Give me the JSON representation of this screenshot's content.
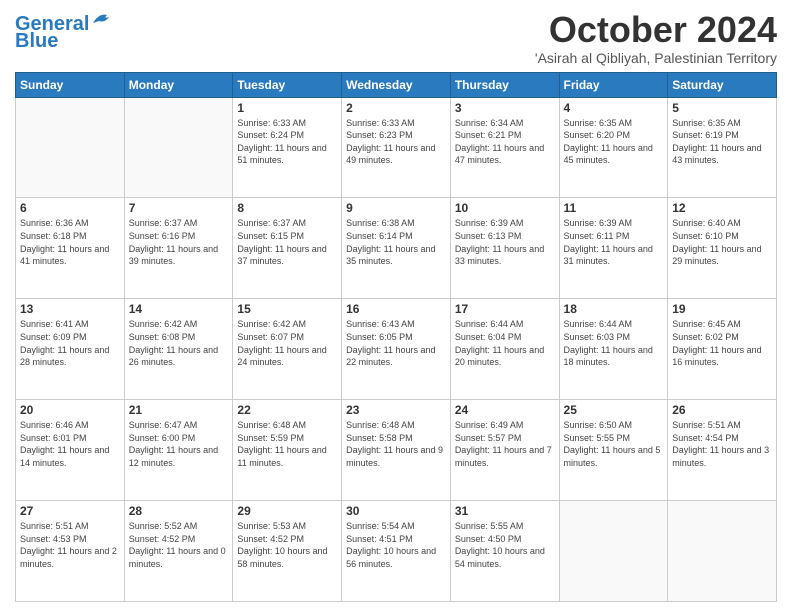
{
  "header": {
    "logo_line1": "General",
    "logo_line2": "Blue",
    "month": "October 2024",
    "location": "'Asirah al Qibliyah, Palestinian Territory"
  },
  "days_of_week": [
    "Sunday",
    "Monday",
    "Tuesday",
    "Wednesday",
    "Thursday",
    "Friday",
    "Saturday"
  ],
  "weeks": [
    [
      {
        "day": "",
        "info": ""
      },
      {
        "day": "",
        "info": ""
      },
      {
        "day": "1",
        "info": "Sunrise: 6:33 AM\nSunset: 6:24 PM\nDaylight: 11 hours and 51 minutes."
      },
      {
        "day": "2",
        "info": "Sunrise: 6:33 AM\nSunset: 6:23 PM\nDaylight: 11 hours and 49 minutes."
      },
      {
        "day": "3",
        "info": "Sunrise: 6:34 AM\nSunset: 6:21 PM\nDaylight: 11 hours and 47 minutes."
      },
      {
        "day": "4",
        "info": "Sunrise: 6:35 AM\nSunset: 6:20 PM\nDaylight: 11 hours and 45 minutes."
      },
      {
        "day": "5",
        "info": "Sunrise: 6:35 AM\nSunset: 6:19 PM\nDaylight: 11 hours and 43 minutes."
      }
    ],
    [
      {
        "day": "6",
        "info": "Sunrise: 6:36 AM\nSunset: 6:18 PM\nDaylight: 11 hours and 41 minutes."
      },
      {
        "day": "7",
        "info": "Sunrise: 6:37 AM\nSunset: 6:16 PM\nDaylight: 11 hours and 39 minutes."
      },
      {
        "day": "8",
        "info": "Sunrise: 6:37 AM\nSunset: 6:15 PM\nDaylight: 11 hours and 37 minutes."
      },
      {
        "day": "9",
        "info": "Sunrise: 6:38 AM\nSunset: 6:14 PM\nDaylight: 11 hours and 35 minutes."
      },
      {
        "day": "10",
        "info": "Sunrise: 6:39 AM\nSunset: 6:13 PM\nDaylight: 11 hours and 33 minutes."
      },
      {
        "day": "11",
        "info": "Sunrise: 6:39 AM\nSunset: 6:11 PM\nDaylight: 11 hours and 31 minutes."
      },
      {
        "day": "12",
        "info": "Sunrise: 6:40 AM\nSunset: 6:10 PM\nDaylight: 11 hours and 29 minutes."
      }
    ],
    [
      {
        "day": "13",
        "info": "Sunrise: 6:41 AM\nSunset: 6:09 PM\nDaylight: 11 hours and 28 minutes."
      },
      {
        "day": "14",
        "info": "Sunrise: 6:42 AM\nSunset: 6:08 PM\nDaylight: 11 hours and 26 minutes."
      },
      {
        "day": "15",
        "info": "Sunrise: 6:42 AM\nSunset: 6:07 PM\nDaylight: 11 hours and 24 minutes."
      },
      {
        "day": "16",
        "info": "Sunrise: 6:43 AM\nSunset: 6:05 PM\nDaylight: 11 hours and 22 minutes."
      },
      {
        "day": "17",
        "info": "Sunrise: 6:44 AM\nSunset: 6:04 PM\nDaylight: 11 hours and 20 minutes."
      },
      {
        "day": "18",
        "info": "Sunrise: 6:44 AM\nSunset: 6:03 PM\nDaylight: 11 hours and 18 minutes."
      },
      {
        "day": "19",
        "info": "Sunrise: 6:45 AM\nSunset: 6:02 PM\nDaylight: 11 hours and 16 minutes."
      }
    ],
    [
      {
        "day": "20",
        "info": "Sunrise: 6:46 AM\nSunset: 6:01 PM\nDaylight: 11 hours and 14 minutes."
      },
      {
        "day": "21",
        "info": "Sunrise: 6:47 AM\nSunset: 6:00 PM\nDaylight: 11 hours and 12 minutes."
      },
      {
        "day": "22",
        "info": "Sunrise: 6:48 AM\nSunset: 5:59 PM\nDaylight: 11 hours and 11 minutes."
      },
      {
        "day": "23",
        "info": "Sunrise: 6:48 AM\nSunset: 5:58 PM\nDaylight: 11 hours and 9 minutes."
      },
      {
        "day": "24",
        "info": "Sunrise: 6:49 AM\nSunset: 5:57 PM\nDaylight: 11 hours and 7 minutes."
      },
      {
        "day": "25",
        "info": "Sunrise: 6:50 AM\nSunset: 5:55 PM\nDaylight: 11 hours and 5 minutes."
      },
      {
        "day": "26",
        "info": "Sunrise: 5:51 AM\nSunset: 4:54 PM\nDaylight: 11 hours and 3 minutes."
      }
    ],
    [
      {
        "day": "27",
        "info": "Sunrise: 5:51 AM\nSunset: 4:53 PM\nDaylight: 11 hours and 2 minutes."
      },
      {
        "day": "28",
        "info": "Sunrise: 5:52 AM\nSunset: 4:52 PM\nDaylight: 11 hours and 0 minutes."
      },
      {
        "day": "29",
        "info": "Sunrise: 5:53 AM\nSunset: 4:52 PM\nDaylight: 10 hours and 58 minutes."
      },
      {
        "day": "30",
        "info": "Sunrise: 5:54 AM\nSunset: 4:51 PM\nDaylight: 10 hours and 56 minutes."
      },
      {
        "day": "31",
        "info": "Sunrise: 5:55 AM\nSunset: 4:50 PM\nDaylight: 10 hours and 54 minutes."
      },
      {
        "day": "",
        "info": ""
      },
      {
        "day": "",
        "info": ""
      }
    ]
  ]
}
